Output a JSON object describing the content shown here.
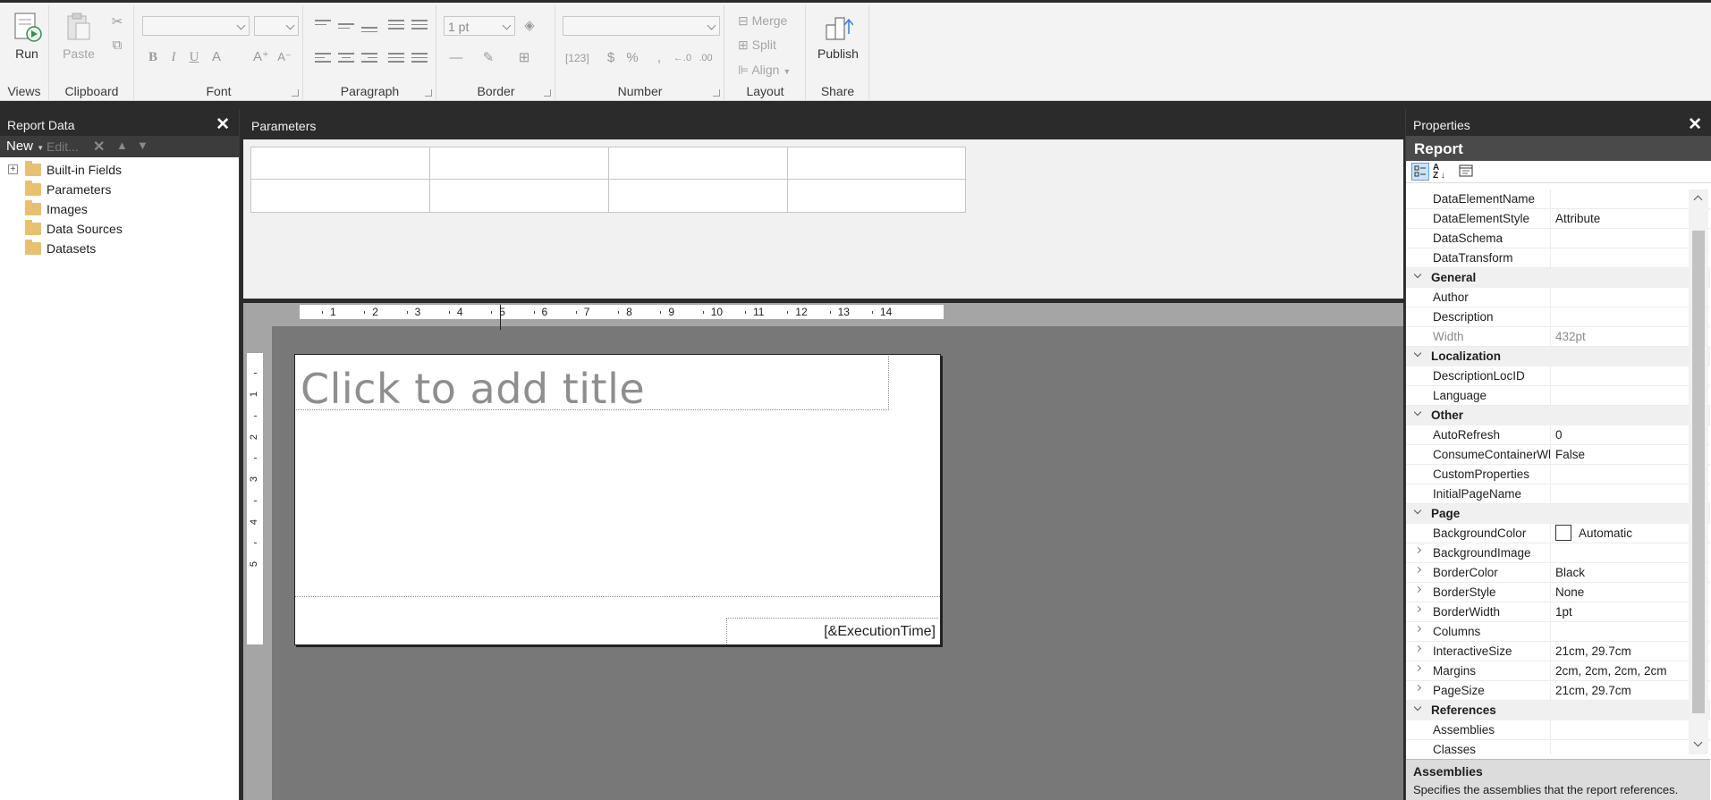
{
  "ribbon": {
    "views": {
      "run_label": "Run",
      "group_label": "Views"
    },
    "clipboard": {
      "paste_label": "Paste",
      "group_label": "Clipboard"
    },
    "font": {
      "group_label": "Font"
    },
    "paragraph": {
      "group_label": "Paragraph"
    },
    "border": {
      "width_value": "1 pt",
      "group_label": "Border"
    },
    "number": {
      "group_label": "Number"
    },
    "layout": {
      "merge_label": "Merge",
      "split_label": "Split",
      "align_label": "Align",
      "group_label": "Layout"
    },
    "share": {
      "publish_label": "Publish",
      "group_label": "Share"
    }
  },
  "report_data": {
    "title": "Report Data",
    "toolbar": {
      "new_label": "New",
      "edit_label": "Edit..."
    },
    "tree": [
      {
        "label": "Built-in Fields",
        "expandable": true
      },
      {
        "label": "Parameters"
      },
      {
        "label": "Images"
      },
      {
        "label": "Data Sources"
      },
      {
        "label": "Datasets"
      }
    ]
  },
  "parameters": {
    "title": "Parameters"
  },
  "design": {
    "ruler_h": [
      "1",
      "2",
      "3",
      "4",
      "5",
      "6",
      "7",
      "8",
      "9",
      "10",
      "11",
      "12",
      "13",
      "14"
    ],
    "ruler_v": [
      "1",
      "2",
      "3",
      "4",
      "5"
    ],
    "title_placeholder": "Click to add title",
    "footer_expression": "[&ExecutionTime]"
  },
  "properties": {
    "title": "Properties",
    "object_name": "Report",
    "rows": [
      {
        "key": "DataElementName",
        "value": ""
      },
      {
        "key": "DataElementStyle",
        "value": "Attribute"
      },
      {
        "key": "DataSchema",
        "value": ""
      },
      {
        "key": "DataTransform",
        "value": ""
      },
      {
        "category": "General"
      },
      {
        "key": "Author",
        "value": ""
      },
      {
        "key": "Description",
        "value": ""
      },
      {
        "key": "Width",
        "value": "432pt",
        "dim": true
      },
      {
        "category": "Localization"
      },
      {
        "key": "DescriptionLocID",
        "value": ""
      },
      {
        "key": "Language",
        "value": ""
      },
      {
        "category": "Other"
      },
      {
        "key": "AutoRefresh",
        "value": "0"
      },
      {
        "key": "ConsumeContainerWhitespace",
        "value": "False"
      },
      {
        "key": "CustomProperties",
        "value": ""
      },
      {
        "key": "InitialPageName",
        "value": ""
      },
      {
        "category": "Page"
      },
      {
        "key": "BackgroundColor",
        "value": "Automatic",
        "swatch": true
      },
      {
        "key": "BackgroundImage",
        "value": "",
        "expandable": true
      },
      {
        "key": "BorderColor",
        "value": "Black",
        "expandable": true
      },
      {
        "key": "BorderStyle",
        "value": "None",
        "expandable": true
      },
      {
        "key": "BorderWidth",
        "value": "1pt",
        "expandable": true
      },
      {
        "key": "Columns",
        "value": "",
        "expandable": true
      },
      {
        "key": "InteractiveSize",
        "value": "21cm, 29.7cm",
        "expandable": true
      },
      {
        "key": "Margins",
        "value": "2cm, 2cm, 2cm, 2cm",
        "expandable": true
      },
      {
        "key": "PageSize",
        "value": "21cm, 29.7cm",
        "expandable": true
      },
      {
        "category": "References"
      },
      {
        "key": "Assemblies",
        "value": ""
      },
      {
        "key": "Classes",
        "value": ""
      }
    ],
    "description": {
      "title": "Assemblies",
      "text": "Specifies the assemblies that the report references."
    }
  }
}
